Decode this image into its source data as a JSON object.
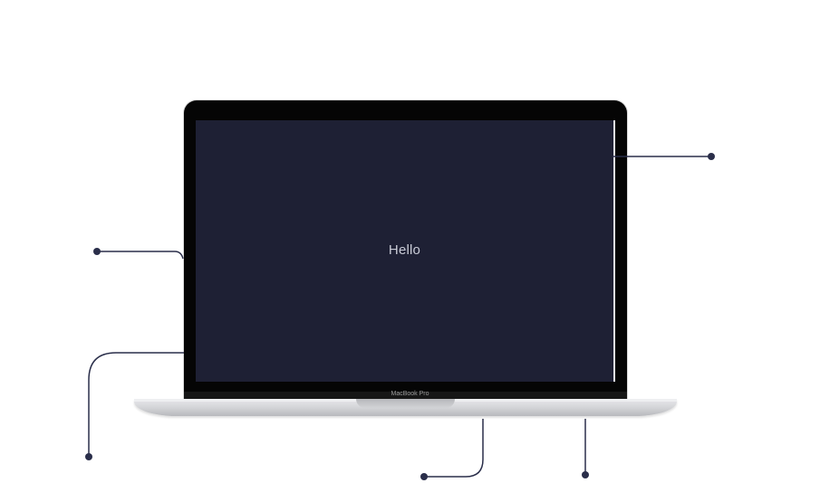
{
  "screen": {
    "text": "Hello"
  },
  "laptop": {
    "brand": "MacBook Pro"
  },
  "colors": {
    "connector": "#2a2e4a",
    "screen_bg": "#1e2034",
    "bezel": "#050505"
  }
}
